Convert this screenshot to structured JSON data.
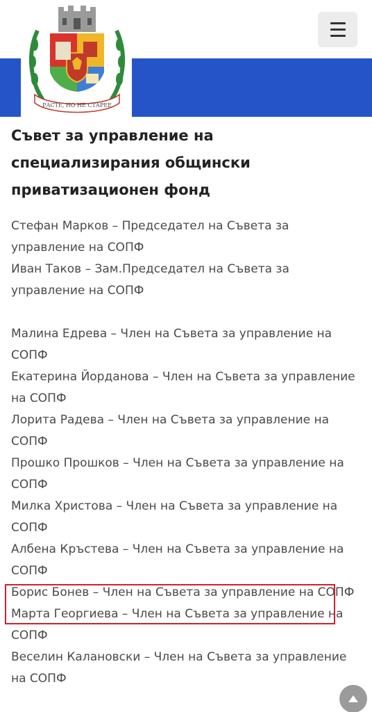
{
  "header": {
    "logo_motto": "РАСТЕ, НО НЕ СТАРЕЕ",
    "menu_icon": "hamburger-menu-icon",
    "brand_blue": "#2454c8"
  },
  "page": {
    "title": "Съвет за управление на специализирания общински приватизационен фонд"
  },
  "members": [
    {
      "text": "Стефан Марков – Председател на Съвета за управление на СОПФ"
    },
    {
      "text": "Иван Таков – Зам.Председател на Съвета за управление на СОПФ"
    },
    {
      "text": "Малина Едрева – Член на Съвета за управление на СОПФ"
    },
    {
      "text": "Екатерина Йорданова – Член на Съвета за управление на СОПФ"
    },
    {
      "text": "Лорита Радева – Член на Съвета за управление на СОПФ"
    },
    {
      "text": "Прошко Прошков – Член на Съвета за управление на СОПФ"
    },
    {
      "text": "Милка Христова – Член на Съвета за управление на СОПФ"
    },
    {
      "text": "Албена Кръстева – Член на Съвета за управление на СОПФ"
    },
    {
      "text": "Борис Бонев – Член на Съвета за управление на СОПФ",
      "highlighted": true
    },
    {
      "text": "Марта Георгиева – Член на Съвета за управление на СОПФ"
    },
    {
      "text": "Веселин Калановски – Член на Съвета за управление на СОПФ"
    }
  ],
  "scroll_top_icon": "chevron-up-icon",
  "highlight_color": "#d0202e"
}
